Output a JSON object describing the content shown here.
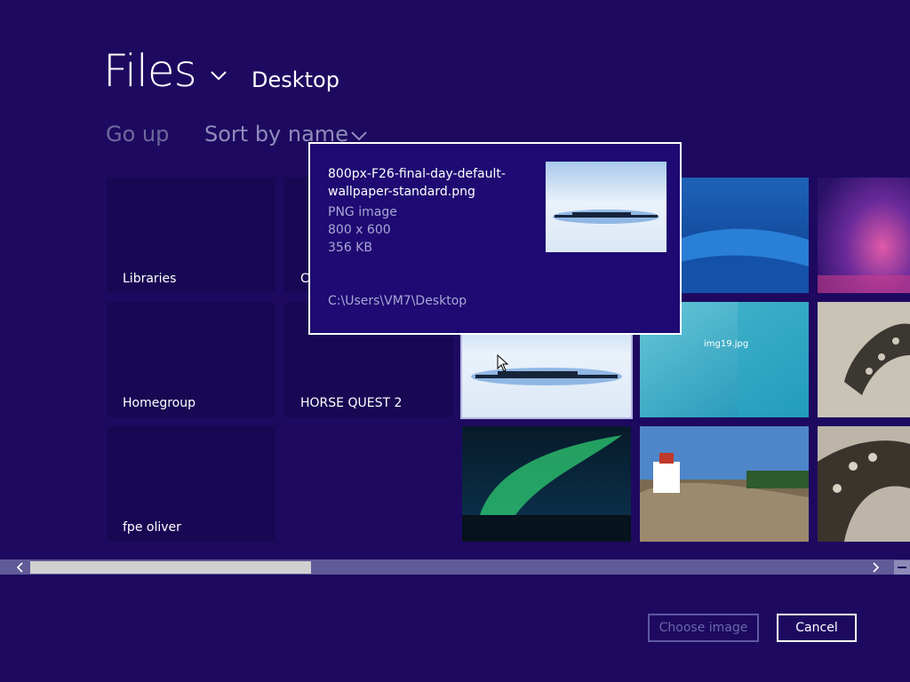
{
  "header": {
    "title": "Files",
    "location": "Desktop"
  },
  "toolbar": {
    "go_up": "Go up",
    "sort": "Sort by name"
  },
  "folders": [
    {
      "label": "Libraries"
    },
    {
      "label": "C"
    },
    {
      "label": "Homegroup"
    },
    {
      "label": "HORSE QUEST 2"
    },
    {
      "label": "fpe oliver"
    }
  ],
  "thumbnails": [
    {
      "name": "wallpaper-blue-wave",
      "overlay_text": ""
    },
    {
      "name": "wallpaper-purple-glow",
      "overlay_text": ""
    },
    {
      "name": "800px-F26-final-day-default-wallpaper-standard.png",
      "overlay_text": ""
    },
    {
      "name": "img19.jpg",
      "overlay_text": "img19.jpg"
    },
    {
      "name": "snake-photo-1",
      "overlay_text": ""
    },
    {
      "name": "aurora",
      "overlay_text": ""
    },
    {
      "name": "lighthouse",
      "overlay_text": ""
    },
    {
      "name": "snake-photo-2",
      "overlay_text": ""
    }
  ],
  "tooltip": {
    "name": "800px-F26-final-day-default-wallpaper-standard.png",
    "type": "PNG image",
    "dimensions": "800 x 600",
    "size": "356 KB",
    "path": "C:\\Users\\VM7\\Desktop"
  },
  "scrollbar": {
    "position_fraction": 0.0,
    "visible_fraction": 0.33
  },
  "buttons": {
    "choose": "Choose image",
    "cancel": "Cancel"
  },
  "colors": {
    "background": "#1d0a60",
    "tile": "#180854",
    "tooltip_bg": "#1e0a72",
    "disabled_text": "#6d6a9e"
  },
  "icons": {
    "title_chevron": "chevron-down-icon",
    "sort_chevron": "chevron-down-icon",
    "scroll_left": "chevron-left-icon",
    "scroll_right": "chevron-right-icon",
    "cursor": "mouse-pointer-icon"
  }
}
